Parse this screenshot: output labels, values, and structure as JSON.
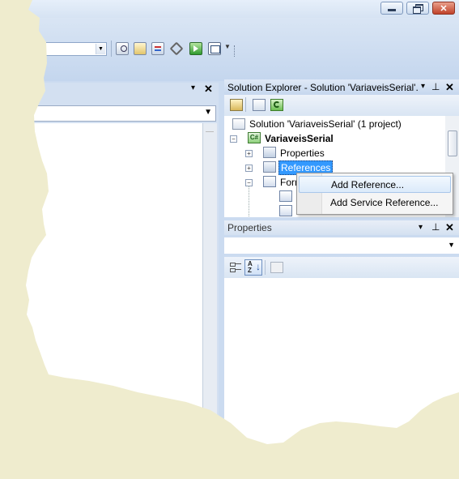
{
  "window": {
    "minimize_glyph": "▁",
    "restore_glyph": "❐",
    "close_glyph": "✕"
  },
  "left_panel": {
    "dropdown_glyph": "▾",
    "close_glyph": "✕"
  },
  "solution_explorer": {
    "title": "Solution Explorer - Solution 'VariaveisSerial'...",
    "pin_glyph": "⊥",
    "close_glyph": "✕",
    "dropdown_glyph": "▾",
    "tree": [
      {
        "label": "Solution 'VariaveisSerial' (1 project)",
        "icon": "solution-icon"
      },
      {
        "label": "VariaveisSerial",
        "icon": "csharp-project-icon",
        "bold": true,
        "expander": "⊟"
      },
      {
        "label": "Properties",
        "icon": "properties-folder-icon",
        "expander": "⊞"
      },
      {
        "label": "References",
        "icon": "references-folder-icon",
        "expander": "⊞",
        "selected": true
      },
      {
        "label": "Form",
        "icon": "form-icon",
        "expander": "⊟"
      }
    ]
  },
  "context_menu": {
    "items": [
      {
        "label": "Add Reference...",
        "highlighted": true
      },
      {
        "label": "Add Service Reference...",
        "highlighted": false
      }
    ]
  },
  "properties": {
    "title": "Properties",
    "pin_glyph": "⊥",
    "close_glyph": "✕",
    "dropdown_glyph": "▾"
  },
  "colors": {
    "ide_blue": "#cbdbf0",
    "selection": "#3399ff",
    "paper": "#efecce"
  }
}
